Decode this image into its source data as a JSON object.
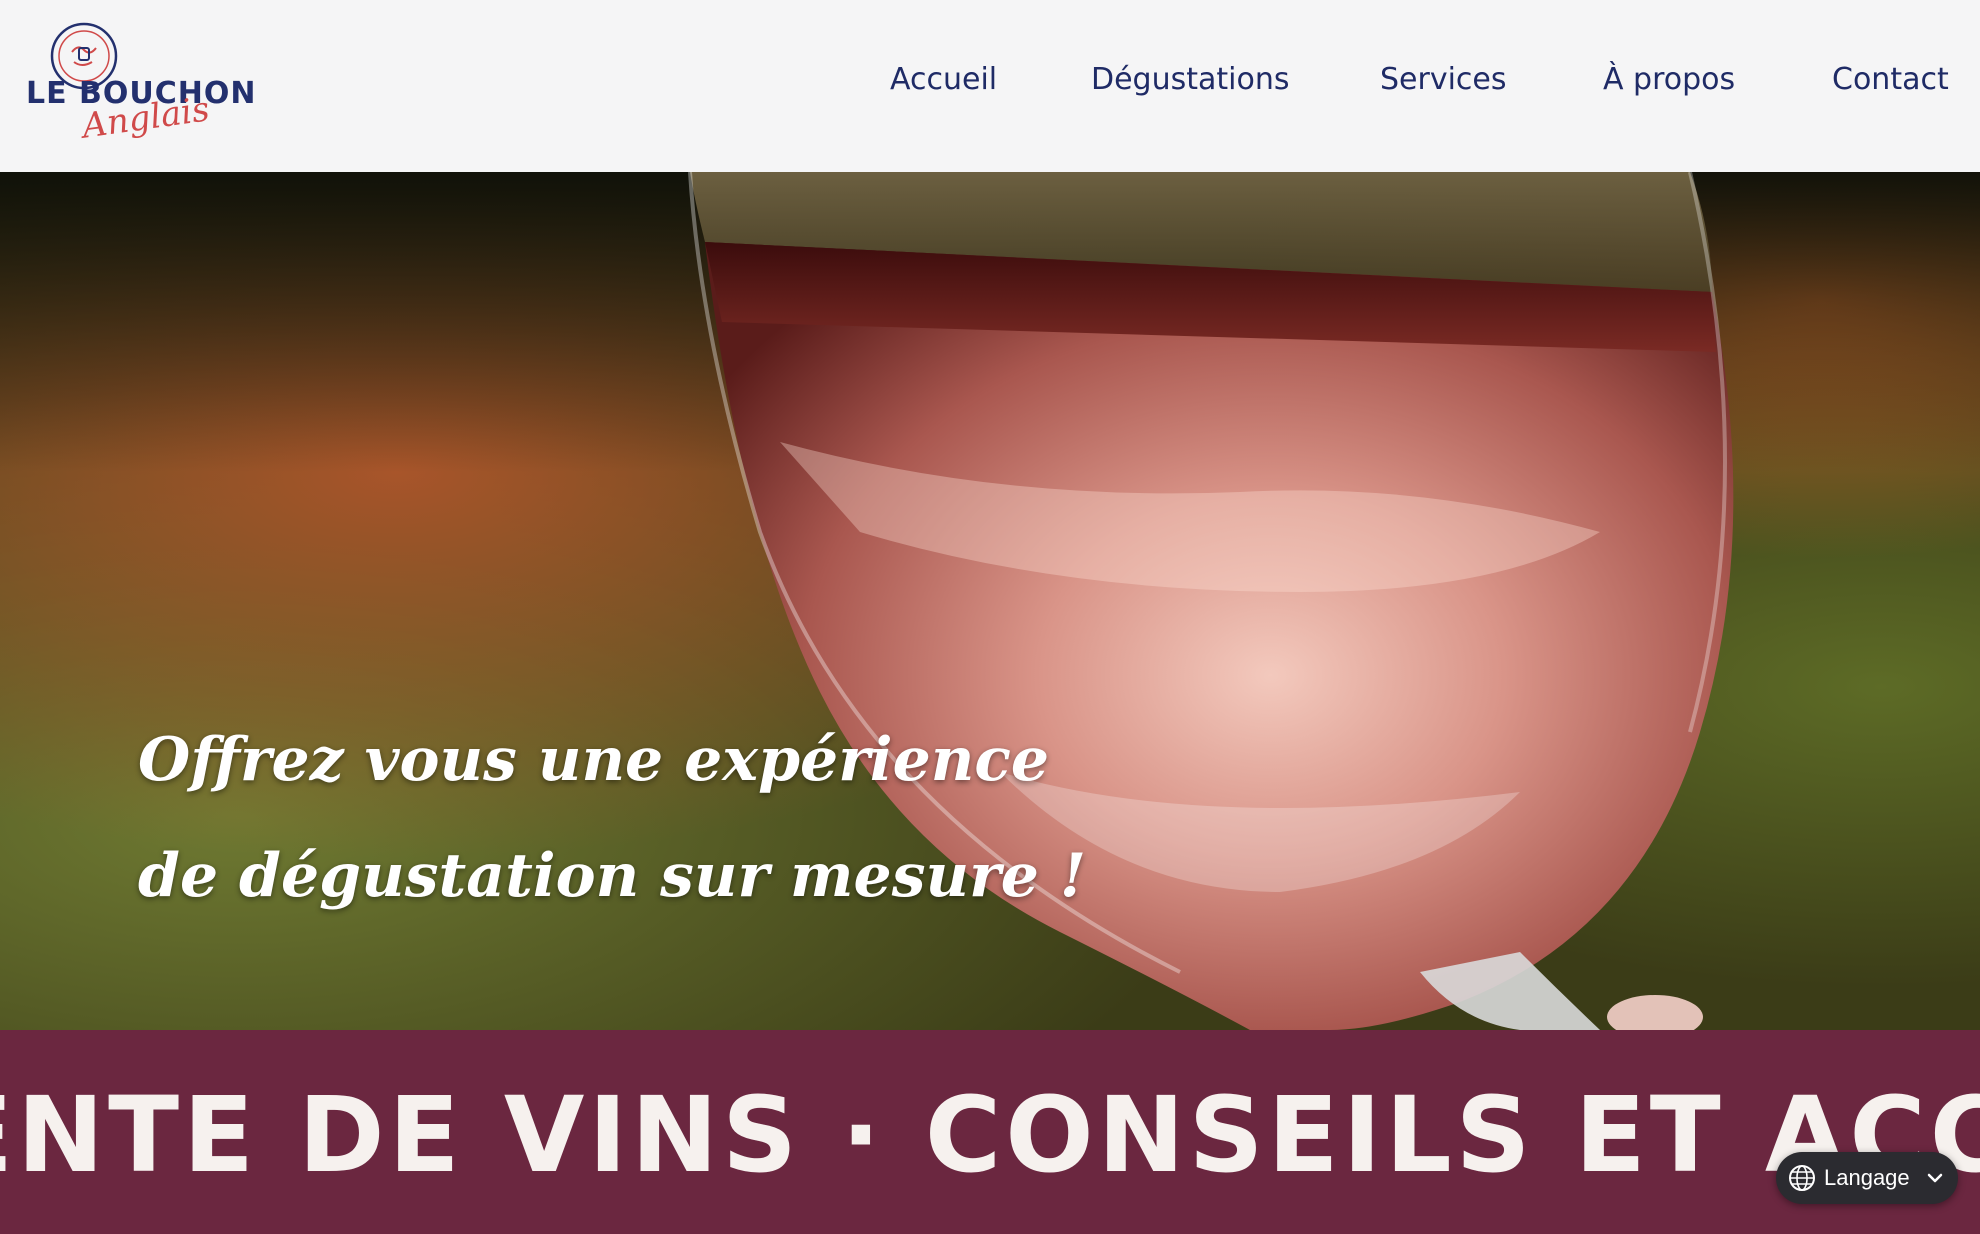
{
  "header": {
    "logo": {
      "main_text": "LE BOUCHON",
      "script_text": "Anglais"
    },
    "nav": [
      {
        "label": "Accueil",
        "name": "nav-item-accueil"
      },
      {
        "label": "Dégustations",
        "name": "nav-item-degustations"
      },
      {
        "label": "Services",
        "name": "nav-item-services"
      },
      {
        "label": "À propos",
        "name": "nav-item-a-propos"
      },
      {
        "label": "Contact",
        "name": "nav-item-contact"
      }
    ]
  },
  "hero": {
    "line1": "Offrez vous une expérience",
    "line2": "de dégustation sur mesure !"
  },
  "banner": {
    "text": "ENTE DE VINS · CONSEILS ET ACCOMPA"
  },
  "language_widget": {
    "label": "Langage",
    "icon": "globe-icon"
  },
  "colors": {
    "header_bg": "#f5f5f6",
    "nav_text": "#1f2b66",
    "logo_blue": "#23306e",
    "logo_red": "#d04a4a",
    "banner_bg": "#6b2740",
    "banner_text": "#f6f1ee"
  }
}
